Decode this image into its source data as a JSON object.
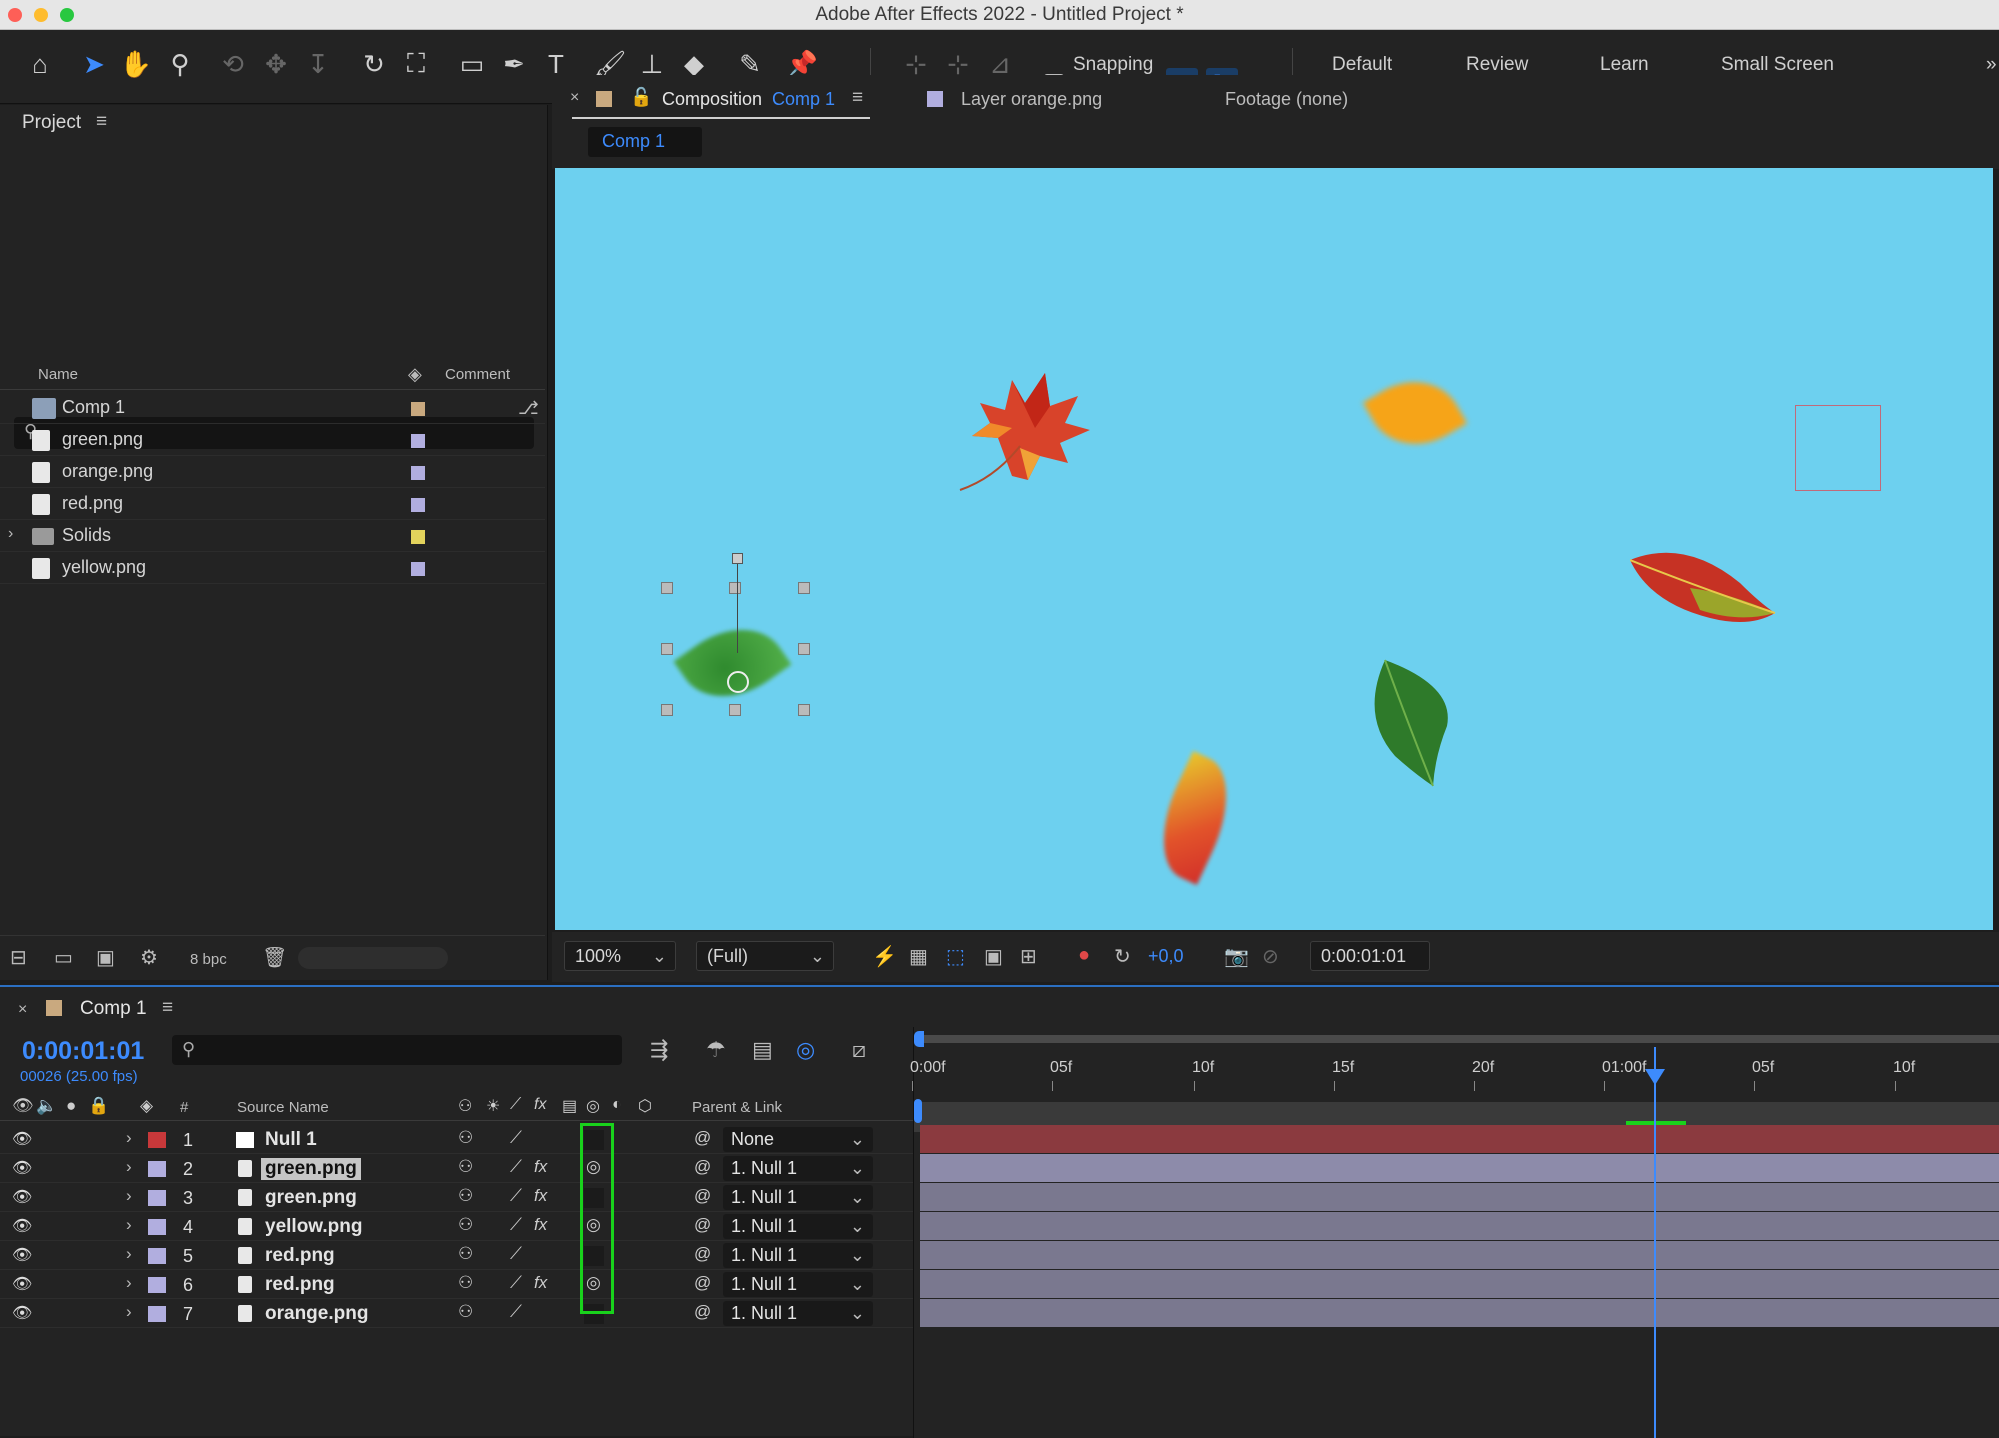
{
  "window": {
    "title": "Adobe After Effects 2022 - Untitled Project *"
  },
  "toolbar": {
    "snapping_label": "Snapping",
    "workspaces": [
      "Default",
      "Review",
      "Learn",
      "Small Screen"
    ]
  },
  "project_panel": {
    "title": "Project",
    "columns": {
      "name": "Name",
      "comment": "Comment"
    },
    "items": [
      {
        "name": "Comp 1",
        "type": "composition",
        "label_color": "#c9a97f"
      },
      {
        "name": "green.png",
        "type": "footage",
        "label_color": "#b1aedf"
      },
      {
        "name": "orange.png",
        "type": "footage",
        "label_color": "#b1aedf"
      },
      {
        "name": "red.png",
        "type": "footage",
        "label_color": "#b1aedf"
      },
      {
        "name": "Solids",
        "type": "folder",
        "label_color": "#e3d35c"
      },
      {
        "name": "yellow.png",
        "type": "footage",
        "label_color": "#b1aedf"
      }
    ],
    "bpc": "8 bpc"
  },
  "viewer_tabs": {
    "composition_prefix": "Composition",
    "composition_name": "Comp 1",
    "layer_tab": "Layer orange.png",
    "footage_tab": "Footage (none)",
    "breadcrumb": "Comp 1"
  },
  "viewer_toolbar": {
    "zoom": "100%",
    "resolution": "(Full)",
    "exposure": "+0,0",
    "timecode": "0:00:01:01"
  },
  "timeline": {
    "tab": "Comp 1",
    "timecode": "0:00:01:01",
    "frame_info": "00026 (25.00 fps)",
    "columns": {
      "source_name": "Source Name",
      "number": "#",
      "parent": "Parent & Link"
    },
    "ruler_labels": [
      "0:00f",
      "05f",
      "10f",
      "15f",
      "20f",
      "01:00f",
      "05f",
      "10f"
    ],
    "layers": [
      {
        "num": "1",
        "name": "Null 1",
        "label_color": "#c8383a",
        "parent": "None",
        "fx": false,
        "mb": false
      },
      {
        "num": "2",
        "name": "green.png",
        "label_color": "#b1aedf",
        "parent": "1. Null 1",
        "fx": true,
        "mb": true,
        "selected": true
      },
      {
        "num": "3",
        "name": "green.png",
        "label_color": "#b1aedf",
        "parent": "1. Null 1",
        "fx": true,
        "mb": false
      },
      {
        "num": "4",
        "name": "yellow.png",
        "label_color": "#b1aedf",
        "parent": "1. Null 1",
        "fx": true,
        "mb": true
      },
      {
        "num": "5",
        "name": "red.png",
        "label_color": "#b1aedf",
        "parent": "1. Null 1",
        "fx": false,
        "mb": false
      },
      {
        "num": "6",
        "name": "red.png",
        "label_color": "#b1aedf",
        "parent": "1. Null 1",
        "fx": true,
        "mb": true
      },
      {
        "num": "7",
        "name": "orange.png",
        "label_color": "#b1aedf",
        "parent": "1. Null 1",
        "fx": false,
        "mb": false
      }
    ]
  },
  "colors": {
    "accent": "#3d8bfd",
    "canvas_bg": "#6dd0ef",
    "highlight_green": "#19d21c"
  }
}
